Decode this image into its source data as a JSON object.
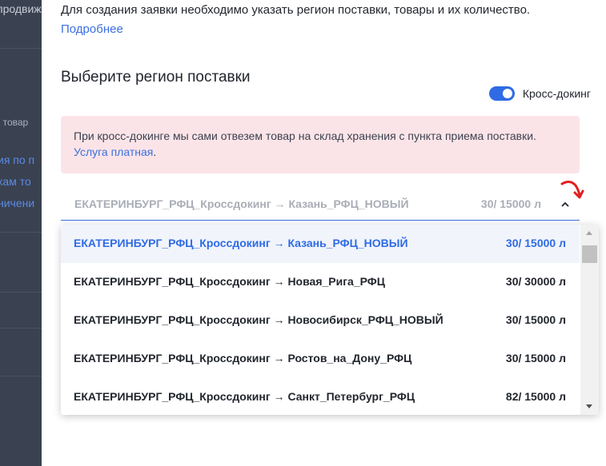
{
  "background": {
    "fragments": [
      "продвиж",
      "ь товар",
      "ия по п",
      "кам то",
      "ничени"
    ]
  },
  "modal": {
    "intro_text": "Для создания заявки необходимо указать регион поставки, товары и их количество.",
    "intro_link": "Подробнее",
    "heading": "Выберите регион поставки",
    "toggle": {
      "label": "Кросс-докинг",
      "on": true,
      "color": "#2f6be4"
    },
    "notice": {
      "text": "При кросс-докинге мы сами отвезем товар на склад хранения с пункта приема поставки.",
      "link": "Услуга платная",
      "suffix": ".",
      "bg_color": "#fbe4e8"
    },
    "select": {
      "value": "ЕКАТЕРИНБУРГ_РФЦ_Кроссдокинг → Казань_РФЦ_НОВЫЙ",
      "amount": "30/ 15000 л",
      "chevron": "chevron-up-icon"
    },
    "options": [
      {
        "label": "ЕКАТЕРИНБУРГ_РФЦ_Кроссдокинг → Казань_РФЦ_НОВЫЙ",
        "amount": "30/ 15000 л",
        "selected": true
      },
      {
        "label": "ЕКАТЕРИНБУРГ_РФЦ_Кроссдокинг → Новая_Рига_РФЦ",
        "amount": "30/ 30000 л",
        "selected": false
      },
      {
        "label": "ЕКАТЕРИНБУРГ_РФЦ_Кроссдокинг → Новосибирск_РФЦ_НОВЫЙ",
        "amount": "30/ 15000 л",
        "selected": false
      },
      {
        "label": "ЕКАТЕРИНБУРГ_РФЦ_Кроссдокинг → Ростов_на_Дону_РФЦ",
        "amount": "30/ 15000 л",
        "selected": false
      },
      {
        "label": "ЕКАТЕРИНБУРГ_РФЦ_Кроссдокинг → Санкт_Петербург_РФЦ",
        "amount": "82/ 15000 л",
        "selected": false
      }
    ],
    "accent_color": "#2f6be4",
    "annotation_arrow_color": "#e02020"
  }
}
